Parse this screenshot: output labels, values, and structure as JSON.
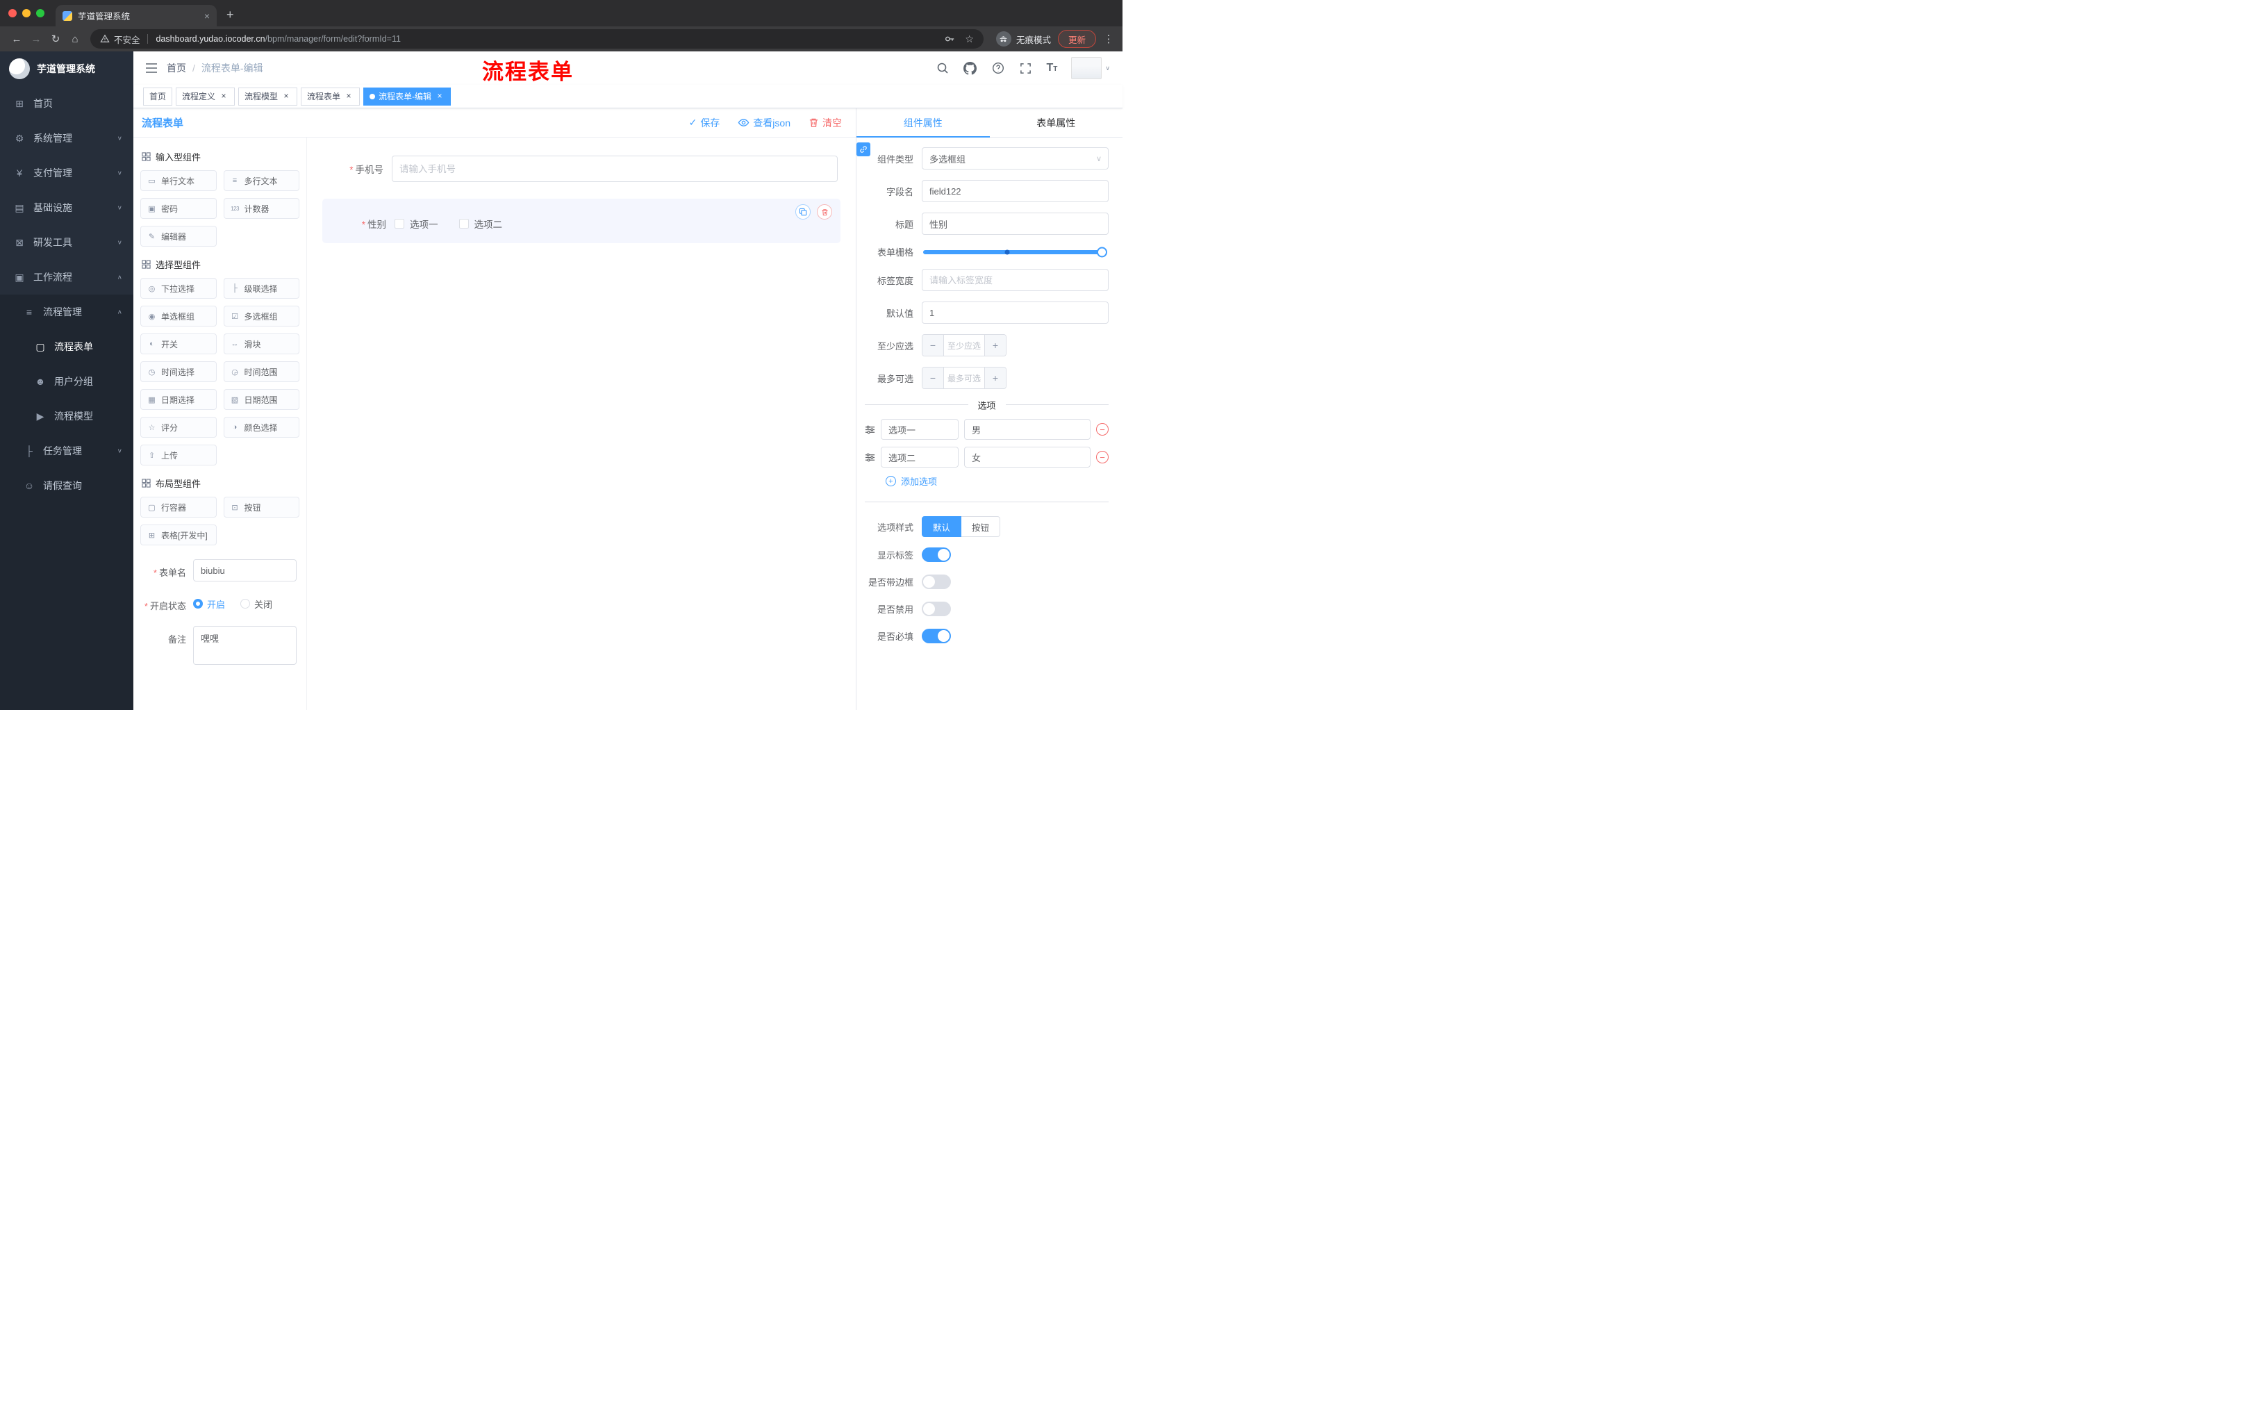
{
  "glyphs": {
    "close": "×",
    "plus": "+",
    "minus": "−",
    "back": "←",
    "forward": "→",
    "reload": "↻",
    "home": "⌂",
    "dots": "⋮",
    "star": "☆",
    "check": "✓",
    "caret": "∨",
    "dot": "●"
  },
  "browser": {
    "tab_title": "芋道管理系统",
    "security_label": "不安全",
    "url_host": "dashboard.yudao.iocoder.cn",
    "url_path": "/bpm/manager/form/edit?formId=11",
    "incognito_label": "无痕模式",
    "update_label": "更新"
  },
  "sidebar": {
    "logo_title": "芋道管理系统",
    "items": [
      {
        "glyph": "⊞",
        "label": "首页",
        "arrow": ""
      },
      {
        "glyph": "⚙",
        "label": "系统管理",
        "arrow": "∨"
      },
      {
        "glyph": "¥",
        "label": "支付管理",
        "arrow": "∨"
      },
      {
        "glyph": "▤",
        "label": "基础设施",
        "arrow": "∨"
      },
      {
        "glyph": "⊠",
        "label": "研发工具",
        "arrow": "∨"
      },
      {
        "glyph": "▣",
        "label": "工作流程",
        "arrow": "∧"
      }
    ],
    "sub_items": [
      {
        "glyph": "≡",
        "label": "流程管理",
        "arrow": "∧"
      },
      {
        "glyph": "▢",
        "label": "流程表单",
        "arrow": ""
      },
      {
        "glyph": "☻",
        "label": "用户分组",
        "arrow": ""
      },
      {
        "glyph": "▶",
        "label": "流程模型",
        "arrow": ""
      },
      {
        "glyph": "├",
        "label": "任务管理",
        "arrow": "∨"
      },
      {
        "glyph": "☺",
        "label": "请假查询",
        "arrow": ""
      }
    ]
  },
  "header": {
    "breadcrumb_home": "首页",
    "breadcrumb_sep": "/",
    "breadcrumb_current": "流程表单-编辑",
    "annotation": "流程表单"
  },
  "tags": [
    {
      "label": "首页"
    },
    {
      "label": "流程定义"
    },
    {
      "label": "流程模型"
    },
    {
      "label": "流程表单"
    },
    {
      "label": "流程表单-编辑"
    }
  ],
  "designer": {
    "panel_title": "流程表单",
    "save_label": "保存",
    "view_json_label": "查看json",
    "clear_label": "清空"
  },
  "palette": {
    "groups": [
      {
        "title": "输入型组件",
        "items": [
          {
            "glyph": "▭",
            "label": "单行文本"
          },
          {
            "glyph": "≡",
            "label": "多行文本"
          },
          {
            "glyph": "▣",
            "label": "密码"
          },
          {
            "glyph": "123",
            "label": "计数器"
          },
          {
            "glyph": "✎",
            "label": "编辑器"
          }
        ]
      },
      {
        "title": "选择型组件",
        "items": [
          {
            "glyph": "◎",
            "label": "下拉选择"
          },
          {
            "glyph": "├",
            "label": "级联选择"
          },
          {
            "glyph": "◉",
            "label": "单选框组"
          },
          {
            "glyph": "☑",
            "label": "多选框组"
          },
          {
            "glyph": "◐",
            "label": "开关"
          },
          {
            "glyph": "↔",
            "label": "滑块"
          },
          {
            "glyph": "◷",
            "label": "时间选择"
          },
          {
            "glyph": "◶",
            "label": "时间范围"
          },
          {
            "glyph": "▦",
            "label": "日期选择"
          },
          {
            "glyph": "▧",
            "label": "日期范围"
          },
          {
            "glyph": "☆",
            "label": "评分"
          },
          {
            "glyph": "◑",
            "label": "颜色选择"
          },
          {
            "glyph": "⇧",
            "label": "上传"
          }
        ]
      },
      {
        "title": "布局型组件",
        "items": [
          {
            "glyph": "▢",
            "label": "行容器"
          },
          {
            "glyph": "⊡",
            "label": "按钮"
          },
          {
            "glyph": "⊞",
            "label": "表格[开发中]"
          }
        ]
      }
    ]
  },
  "meta_form": {
    "name_label": "表单名",
    "name_value": "biubiu",
    "status_label": "开启状态",
    "status_on": "开启",
    "status_off": "关闭",
    "remark_label": "备注",
    "remark_value": "嘿嘿"
  },
  "canvas": {
    "phone_label": "手机号",
    "phone_placeholder": "请输入手机号",
    "gender_label": "性别",
    "gender_opt1": "选项一",
    "gender_opt2": "选项二"
  },
  "props": {
    "tab_component": "组件属性",
    "tab_form": "表单属性",
    "type_label": "组件类型",
    "type_value": "多选框组",
    "field_label": "字段名",
    "field_value": "field122",
    "title_label": "标题",
    "title_value": "性别",
    "grid_label": "表单栅格",
    "width_label": "标签宽度",
    "width_placeholder": "请输入标签宽度",
    "default_label": "默认值",
    "default_value": "1",
    "min_label": "至少应选",
    "min_placeholder": "至少应选",
    "max_label": "最多可选",
    "max_placeholder": "最多可选",
    "options_divider": "选项",
    "options": [
      {
        "name": "选项一",
        "value": "男"
      },
      {
        "name": "选项二",
        "value": "女"
      }
    ],
    "add_option_label": "添加选项",
    "style_label": "选项样式",
    "style_default": "默认",
    "style_button": "按钮",
    "show_label": "显示标签",
    "border_label": "是否带边框",
    "disabled_label": "是否禁用",
    "required_label": "是否必填"
  },
  "colors": {
    "primary": "#409eff",
    "danger": "#f56c6c",
    "annotation": "#fe0500"
  }
}
